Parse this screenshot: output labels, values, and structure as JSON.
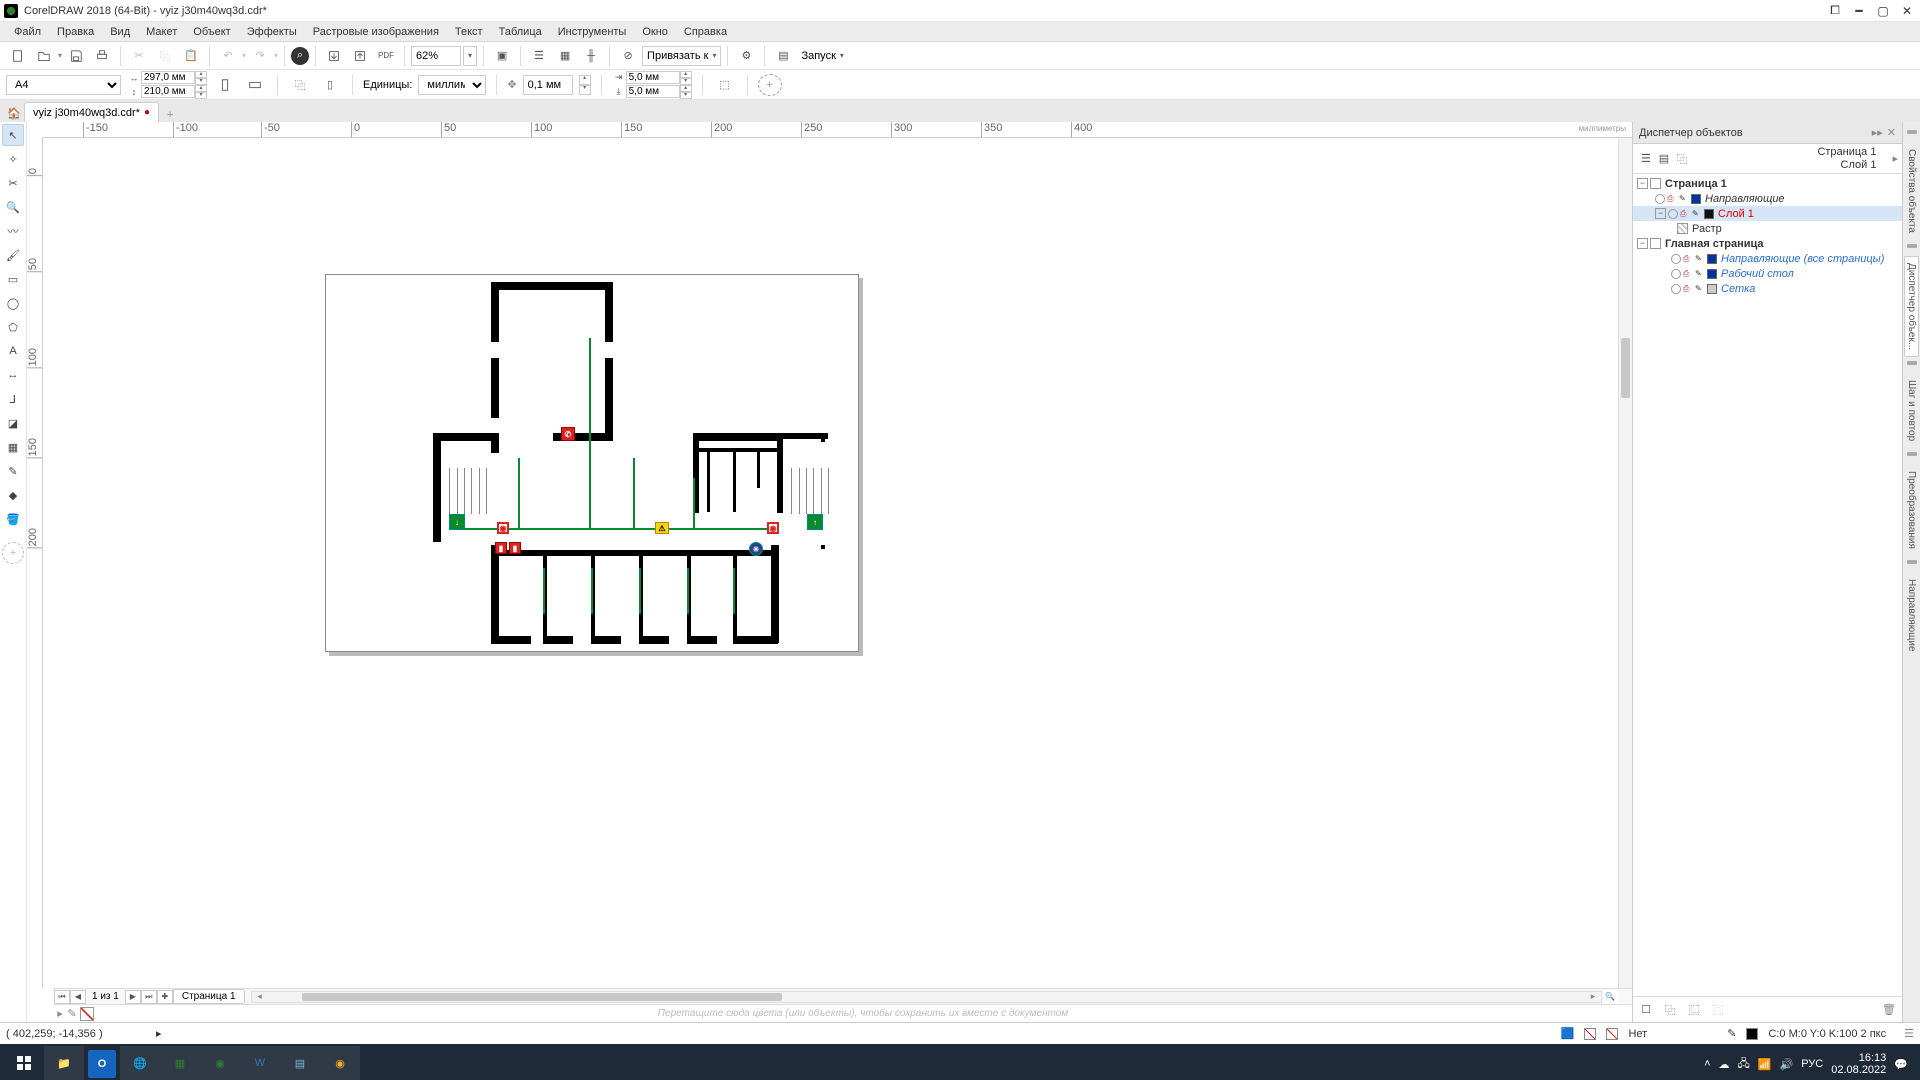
{
  "app": {
    "title": "CorelDRAW 2018 (64-Bit) - vyiz j30m40wq3d.cdr*"
  },
  "menu": [
    "Файл",
    "Правка",
    "Вид",
    "Макет",
    "Объект",
    "Эффекты",
    "Растровые изображения",
    "Текст",
    "Таблица",
    "Инструменты",
    "Окно",
    "Справка"
  ],
  "toolbar": {
    "zoom": "62%",
    "snap_label": "Привязать к",
    "launch_label": "Запуск"
  },
  "propbar": {
    "paper": "A4",
    "width": "297,0 мм",
    "height": "210,0 мм",
    "units_label": "Единицы:",
    "units_value": "миллимет...",
    "nudge": "0,1 мм",
    "dup_x": "5,0 мм",
    "dup_y": "5,0 мм"
  },
  "doc": {
    "tab_name": "vyiz j30m40wq3d.cdr*"
  },
  "ruler": {
    "h": [
      "-150",
      "-100",
      "-50",
      "0",
      "50",
      "100",
      "150",
      "200",
      "250",
      "300",
      "350",
      "400"
    ],
    "h_unit": "миллиметры",
    "v": [
      "0",
      "50",
      "100",
      "150",
      "200"
    ]
  },
  "pagenav": {
    "counter": "1 из 1",
    "page_tab": "Страница 1"
  },
  "color_hint": "Перетащите сюда цвета (или объекты), чтобы сохранить их вместе с документом",
  "objmgr": {
    "title": "Диспетчер объектов",
    "head_page": "Страница 1",
    "head_layer": "Слой 1",
    "header_arrow": "▸",
    "tree": {
      "page1": "Страница 1",
      "guides": "Направляющие",
      "layer1": "Слой 1",
      "raster": "Растр",
      "master": "Главная страница",
      "guides_all": "Направляющие (все страницы)",
      "desktop": "Рабочий стол",
      "grid": "Сетка"
    }
  },
  "vdock": [
    "Свойства объекта",
    "Диспетчер объек...",
    "Шаг и повтор",
    "Преобразования",
    "Направляющие"
  ],
  "status": {
    "coords": "( 402,259; -14,356 )",
    "arrow": "▸",
    "fill_label": "Нет",
    "color_info": "C:0 M:0 Y:0 K:100  2 пкс"
  },
  "taskbar": {
    "lang": "РУС",
    "time": "16:13",
    "date": "02.08.2022"
  }
}
